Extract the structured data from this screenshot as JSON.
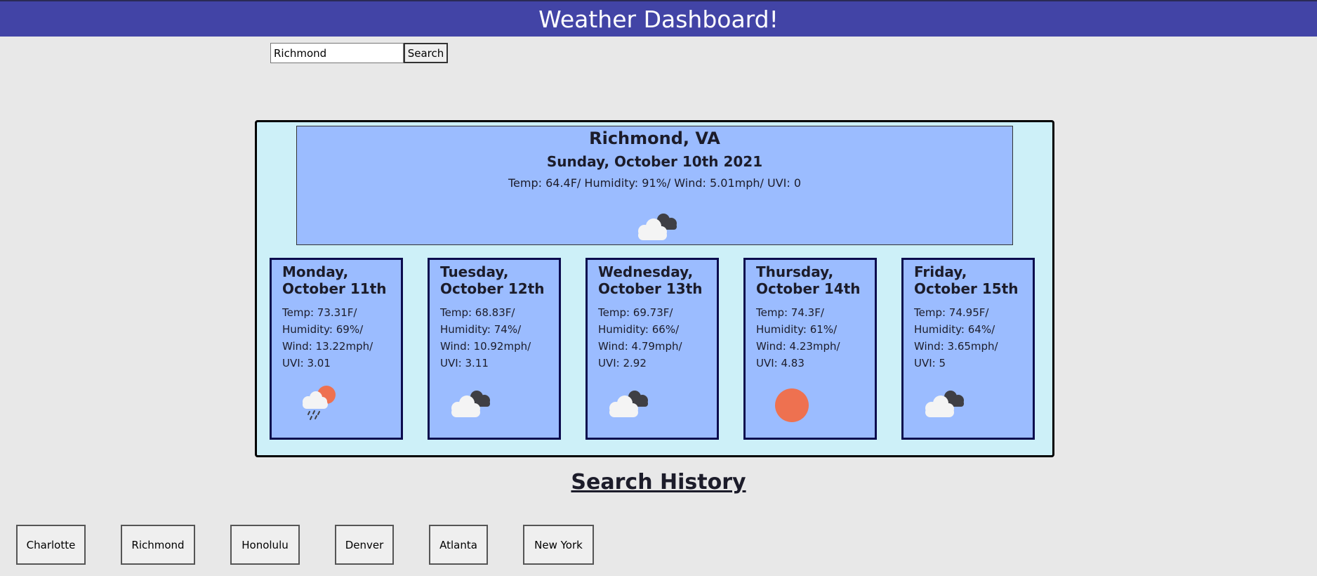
{
  "header": {
    "title": "Weather Dashboard!"
  },
  "search": {
    "value": "Richmond",
    "button_label": "Search"
  },
  "current": {
    "city": "Richmond, VA",
    "date": "Sunday, October 10th 2021",
    "stats": "Temp: 64.4F/ Humidity: 91%/ Wind: 5.01mph/ UVI: 0",
    "icon": "cloudy-icon"
  },
  "forecast": [
    {
      "day": "Monday, October 11th",
      "stats": "Temp: 73.31F/ Humidity: 69%/ Wind: 13.22mph/ UVI: 3.01",
      "icon": "rain-sun-icon"
    },
    {
      "day": "Tuesday, October 12th",
      "stats": "Temp: 68.83F/ Humidity: 74%/ Wind: 10.92mph/ UVI: 3.11",
      "icon": "cloudy-icon"
    },
    {
      "day": "Wednesday, October 13th",
      "stats": "Temp: 69.73F/ Humidity: 66%/ Wind: 4.79mph/ UVI: 2.92",
      "icon": "cloudy-icon"
    },
    {
      "day": "Thursday, October 14th",
      "stats": "Temp: 74.3F/ Humidity: 61%/ Wind: 4.23mph/ UVI: 4.83",
      "icon": "sun-icon"
    },
    {
      "day": "Friday, October 15th",
      "stats": "Temp: 74.95F/ Humidity: 64%/ Wind: 3.65mph/ UVI: 5",
      "icon": "cloudy-icon"
    }
  ],
  "history": {
    "title": "Search History",
    "items": [
      "Charlotte",
      "Richmond",
      "Honolulu",
      "Denver",
      "Atlanta",
      "New York"
    ]
  },
  "colors": {
    "header_bg": "#4244a6",
    "panel_bg": "#cdf0f8",
    "card_bg": "#9bbcff",
    "sun": "#ee7150"
  }
}
